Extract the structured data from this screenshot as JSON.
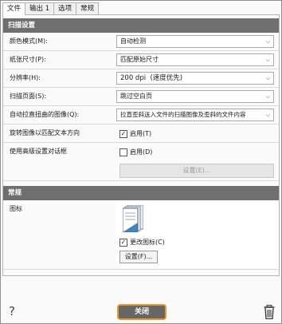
{
  "tabs": [
    {
      "label": "文件"
    },
    {
      "label": "输出 1"
    },
    {
      "label": "选项"
    },
    {
      "label": "常规"
    }
  ],
  "scan_settings": {
    "header": "扫描设置",
    "color_mode": {
      "label": "颜色模式(M):",
      "value": "自动检测"
    },
    "paper_size": {
      "label": "纸张尺寸(P):",
      "value": "匹配原始尺寸"
    },
    "resolution": {
      "label": "分辨率(H):",
      "value": "200 dpi  (速度优先)"
    },
    "scan_page": {
      "label": "扫描页面(S):",
      "value": "跳过空白页"
    },
    "deskew": {
      "label": "自动拉直扭曲的图像(Q):",
      "value": "拉直歪斜送入文件的扫描图像及歪斜的文件内容"
    },
    "rotate": {
      "label": "旋转图像以匹配文本方向",
      "checkbox_label": "启用(T)",
      "checked": true
    },
    "advanced": {
      "label": "使用高级设置对话框",
      "checkbox_label": "启用(D)",
      "checked": false,
      "button_label": "设置(E)..."
    }
  },
  "general": {
    "header": "常规",
    "icon_label": "图标",
    "change_icon": {
      "label": "更改图标(C)",
      "checked": true
    },
    "settings_button": "设置(F)..."
  },
  "footer": {
    "help_glyph": "?",
    "close_label": "关闭"
  },
  "icons": [
    "help-icon",
    "document-icon",
    "trash-icon",
    "chevron-down-icon",
    "checkmark-icon"
  ]
}
